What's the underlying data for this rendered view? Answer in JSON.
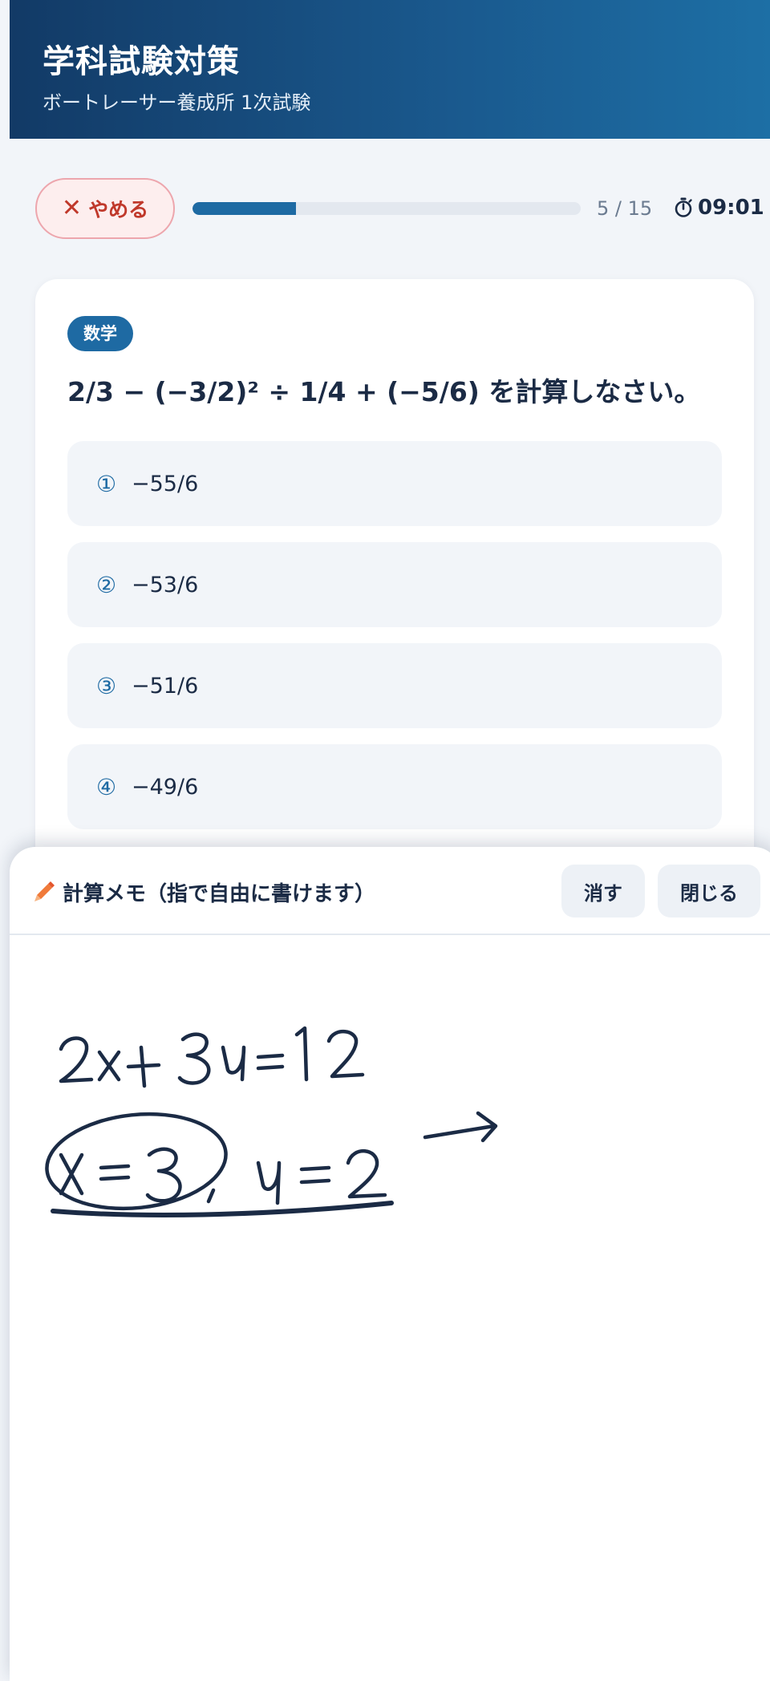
{
  "header": {
    "title": "学科試験対策",
    "subtitle": "ボートレーサー養成所 1次試験"
  },
  "toolbar": {
    "quit_label": "やめる",
    "quit_icon": "close-icon",
    "progress": {
      "current": 5,
      "total": 15,
      "fraction": 0.2667,
      "text": "5 / 15"
    },
    "timer_icon": "stopwatch-icon",
    "timer": "09:01"
  },
  "question": {
    "subject": "数学",
    "text": "2/3 − (−3/2)² ÷ 1/4 + (−5/6) を計算しなさい。",
    "options": [
      {
        "number": "①",
        "text": "−55/6"
      },
      {
        "number": "②",
        "text": "−53/6"
      },
      {
        "number": "③",
        "text": "−51/6"
      },
      {
        "number": "④",
        "text": "−49/6"
      }
    ]
  },
  "memo": {
    "icon": "pencil-icon",
    "title": "計算メモ（指で自由に書けます）",
    "clear_label": "消す",
    "close_label": "閉じる",
    "handwriting": [
      "2x + 3y = 12",
      "x = 3, y = 2"
    ]
  },
  "colors": {
    "accent": "#1e6aa3",
    "header_dark": "#123a66",
    "danger": "#c0392b",
    "ink": "#1b2b45"
  }
}
